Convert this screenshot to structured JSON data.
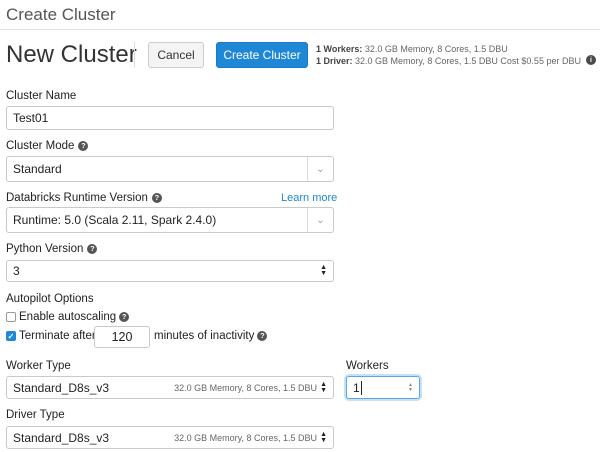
{
  "header": {
    "top_title": "Create Cluster",
    "page_title": "New Cluster",
    "cancel_label": "Cancel",
    "create_label": "Create Cluster",
    "summary_workers_bold": "1 Workers:",
    "summary_workers_text": " 32.0 GB Memory, 8 Cores, 1.5 DBU",
    "summary_driver_bold": "1 Driver:",
    "summary_driver_text": " 32.0 GB Memory, 8 Cores, 1.5 DBU Cost $0.55 per DBU",
    "dbu_icon": "i"
  },
  "form": {
    "cluster_name": {
      "label": "Cluster Name",
      "value": "Test01"
    },
    "cluster_mode": {
      "label": "Cluster Mode",
      "value": "Standard"
    },
    "runtime": {
      "label": "Databricks Runtime Version",
      "learn_more": "Learn more",
      "value": "Runtime: 5.0 (Scala 2.11, Spark 2.4.0)"
    },
    "python": {
      "label": "Python Version",
      "value": "3"
    },
    "autopilot": {
      "label": "Autopilot Options",
      "autoscaling_label": "Enable autoscaling",
      "autoscaling_checked": false,
      "terminate_label": "Terminate after",
      "terminate_checked": true,
      "terminate_minutes": "120",
      "terminate_suffix": "minutes of inactivity"
    },
    "worker_type": {
      "label": "Worker Type",
      "value": "Standard_D8s_v3",
      "meta": "32.0 GB Memory, 8 Cores, 1.5 DBU"
    },
    "workers": {
      "label": "Workers",
      "value": "1"
    },
    "driver_type": {
      "label": "Driver Type",
      "value": "Standard_D8s_v3",
      "meta": "32.0 GB Memory, 8 Cores, 1.5 DBU"
    }
  },
  "icons": {
    "help": "?",
    "chevron": "⌄",
    "check": "✓",
    "arrow_up": "▲",
    "arrow_down": "▼"
  },
  "colors": {
    "accent": "#1f88d6",
    "border": "#c9c9c9"
  }
}
